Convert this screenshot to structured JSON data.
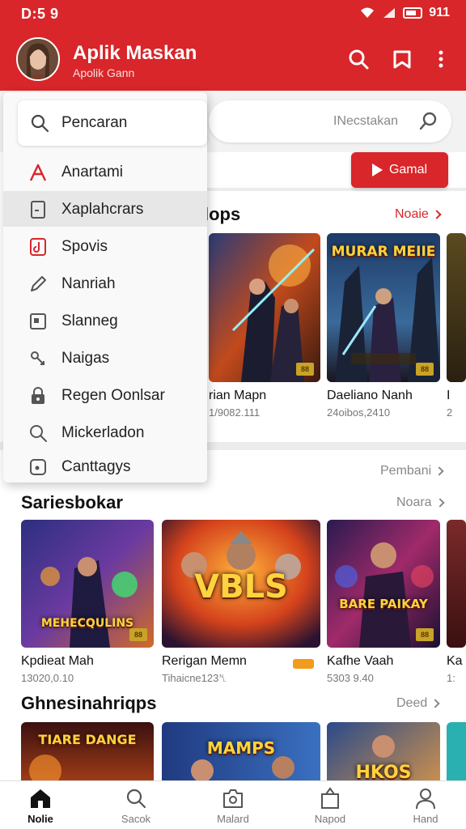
{
  "status_bar": {
    "time": "D:5 9",
    "battery_text": "911"
  },
  "app_bar": {
    "title": "Aplik Maskan",
    "subtitle": "Apolik Gann"
  },
  "search": {
    "placeholder": "INecstakan"
  },
  "play_button": {
    "label": "Gamal"
  },
  "section1": {
    "title": "lops",
    "more": "Noaie",
    "games": [
      {
        "name": "rian Mapn",
        "meta": "1/9082.111",
        "art_text": ""
      },
      {
        "name": "Daeliano Nanh",
        "meta": "24oibos,2410",
        "art_text": "MURAR MEIIE"
      },
      {
        "name": "I",
        "meta": "2",
        "art_text": ""
      }
    ]
  },
  "section_pembani": {
    "more": "Pembani"
  },
  "section2": {
    "title": "Sariesbokar",
    "more": "Noara",
    "games": [
      {
        "name": "Kpdieat Mah",
        "meta": "13020,0.10",
        "art_text": "MEHECQULINS"
      },
      {
        "name": "Rerigan Memn",
        "meta": "Tihaicne123␤",
        "art_text": "VBLS"
      },
      {
        "name": "Kafhe Vaah",
        "meta": "5303 9.40",
        "art_text": "BARE PAIKAY"
      },
      {
        "name": "Ka",
        "meta": "1:",
        "art_text": ""
      }
    ]
  },
  "section3": {
    "title": "Ghnesinahriqps",
    "more": "Deed",
    "games": [
      {
        "art_text": "TIARE DANGE"
      },
      {
        "art_text": "MAMPS"
      },
      {
        "art_text": "HKOS"
      }
    ]
  },
  "drawer": {
    "search_label": "Pencaran",
    "items": [
      {
        "label": "Anartami",
        "icon": "a-icon"
      },
      {
        "label": "Xaplahcrars",
        "icon": "document-icon"
      },
      {
        "label": "Spovis",
        "icon": "music-note-icon"
      },
      {
        "label": "Nanriah",
        "icon": "pencil-icon"
      },
      {
        "label": "Slanneg",
        "icon": "picture-icon"
      },
      {
        "label": "Naigas",
        "icon": "link-icon"
      },
      {
        "label": "Regen Oonlsar",
        "icon": "lock-icon"
      },
      {
        "label": "Mickerladon",
        "icon": "search-icon"
      },
      {
        "label": "Canttagys",
        "icon": "tag-icon"
      }
    ]
  },
  "bottom_nav": [
    {
      "label": "Nolie",
      "icon": "home-icon",
      "active": true
    },
    {
      "label": "Sacok",
      "icon": "search-icon"
    },
    {
      "label": "Malard",
      "icon": "camera-icon"
    },
    {
      "label": "Napod",
      "icon": "bag-icon"
    },
    {
      "label": "Hand",
      "icon": "profile-icon"
    }
  ],
  "colors": {
    "accent": "#d8262a",
    "badge_gold": "#c9a227",
    "tag_orange": "#f29b1c"
  }
}
